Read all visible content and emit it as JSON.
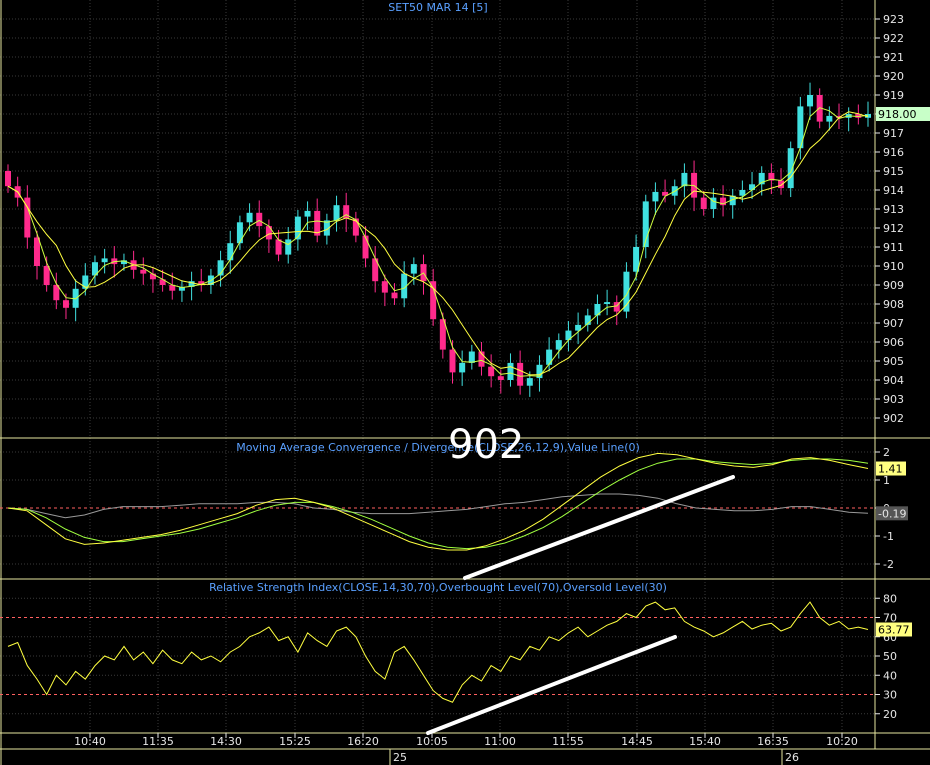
{
  "chart_data": [
    {
      "type": "candlestick",
      "title": "SET50 MAR 14   [5]",
      "ylim": [
        901,
        924
      ],
      "yticks": [
        902,
        903,
        904,
        905,
        906,
        907,
        908,
        909,
        910,
        911,
        912,
        913,
        914,
        915,
        916,
        917,
        918,
        919,
        920,
        921,
        922,
        923
      ],
      "last_price": "918.00",
      "annotation": "902",
      "colors": {
        "up": "#40e0e0",
        "down": "#ff2a8c",
        "ma": "#ffff40",
        "ma2": "#d0ff40",
        "tag_bg": "#c8ffc8"
      },
      "closes": [
        914.2,
        913.6,
        911.5,
        910.0,
        909.0,
        908.2,
        907.8,
        908.8,
        909.5,
        910.2,
        910.4,
        910.1,
        910.3,
        909.8,
        909.6,
        909.3,
        909.0,
        908.7,
        908.9,
        909.2,
        909.0,
        909.5,
        910.3,
        911.2,
        912.3,
        912.8,
        912.1,
        911.4,
        910.6,
        911.4,
        912.6,
        912.9,
        911.6,
        912.4,
        913.2,
        912.5,
        911.6,
        910.4,
        909.2,
        908.6,
        908.3,
        909.6,
        910.1,
        909.2,
        907.2,
        905.6,
        904.4,
        904.9,
        905.5,
        904.7,
        904.2,
        904.0,
        904.9,
        903.7,
        904.1,
        904.8,
        905.6,
        906.1,
        906.6,
        906.9,
        907.4,
        908.0,
        908.1,
        907.6,
        909.7,
        911.0,
        913.4,
        913.9,
        913.7,
        914.2,
        914.9,
        913.6,
        913.0,
        913.6,
        913.2,
        913.7,
        914.0,
        914.3,
        914.9,
        914.5,
        914.1,
        916.2,
        918.4,
        919.0,
        917.6,
        917.9,
        917.8,
        918.0,
        917.8,
        918.0
      ],
      "note_closes": "approximate closes read from candles; OHLC derived"
    },
    {
      "type": "line",
      "title": "Moving Average Convergence / Divergence(CLOSE,26,12,9),Value Line(0)",
      "ylim": [
        -2.5,
        2.5
      ],
      "yticks": [
        -2,
        -1,
        0,
        1,
        2
      ],
      "labels": {
        "macd": "1.41",
        "hist": "-0.19"
      },
      "colors": {
        "macd": "#ffff40",
        "signal": "#a0ff40",
        "hist": "#9a9a9a",
        "zero": "#ff6060",
        "tag_bg": "#ffff80"
      },
      "macd": [
        0.0,
        -0.1,
        -0.6,
        -1.1,
        -1.3,
        -1.25,
        -1.15,
        -1.05,
        -0.95,
        -0.8,
        -0.6,
        -0.4,
        -0.2,
        0.1,
        0.3,
        0.35,
        0.2,
        0.0,
        -0.3,
        -0.6,
        -0.9,
        -1.2,
        -1.4,
        -1.5,
        -1.5,
        -1.35,
        -1.1,
        -0.8,
        -0.4,
        0.1,
        0.6,
        1.1,
        1.5,
        1.8,
        1.95,
        1.9,
        1.75,
        1.6,
        1.5,
        1.45,
        1.55,
        1.75,
        1.8,
        1.7,
        1.55,
        1.41
      ],
      "signal": [
        0.0,
        -0.05,
        -0.35,
        -0.75,
        -1.05,
        -1.2,
        -1.2,
        -1.1,
        -1.0,
        -0.9,
        -0.75,
        -0.55,
        -0.35,
        -0.1,
        0.1,
        0.2,
        0.2,
        0.05,
        -0.15,
        -0.4,
        -0.7,
        -1.0,
        -1.25,
        -1.4,
        -1.45,
        -1.4,
        -1.25,
        -1.0,
        -0.7,
        -0.3,
        0.15,
        0.6,
        1.0,
        1.35,
        1.6,
        1.75,
        1.75,
        1.65,
        1.6,
        1.55,
        1.6,
        1.7,
        1.75,
        1.75,
        1.7,
        1.6
      ],
      "hist": [
        0.0,
        -0.05,
        -0.2,
        -0.35,
        -0.25,
        -0.05,
        0.05,
        0.05,
        0.05,
        0.1,
        0.15,
        0.15,
        0.15,
        0.2,
        0.2,
        0.15,
        0.0,
        -0.05,
        -0.15,
        -0.2,
        -0.2,
        -0.2,
        -0.15,
        -0.1,
        -0.05,
        0.05,
        0.15,
        0.2,
        0.3,
        0.4,
        0.45,
        0.5,
        0.5,
        0.45,
        0.35,
        0.15,
        0.0,
        -0.05,
        -0.1,
        -0.1,
        -0.05,
        0.05,
        0.05,
        -0.05,
        -0.15,
        -0.19
      ]
    },
    {
      "type": "line",
      "title": "Relative Strength Index(CLOSE,14,30,70),Overbought Level(70),Oversold Level(30)",
      "ylim": [
        10,
        90
      ],
      "yticks": [
        20,
        30,
        40,
        50,
        60,
        70,
        80
      ],
      "levels": [
        30,
        70
      ],
      "label": "63.77",
      "colors": {
        "rsi": "#ffff40",
        "level": "#ff6060",
        "tag_bg": "#ffff80"
      },
      "values": [
        55,
        57,
        45,
        38,
        30,
        40,
        35,
        42,
        38,
        45,
        50,
        48,
        55,
        48,
        52,
        46,
        53,
        48,
        46,
        52,
        48,
        50,
        47,
        52,
        55,
        60,
        62,
        65,
        58,
        60,
        52,
        62,
        58,
        55,
        63,
        65,
        60,
        50,
        42,
        38,
        52,
        55,
        48,
        40,
        32,
        28,
        26,
        35,
        40,
        37,
        45,
        42,
        50,
        48,
        55,
        53,
        60,
        58,
        62,
        65,
        60,
        63,
        66,
        68,
        72,
        70,
        76,
        78,
        74,
        75,
        68,
        65,
        63,
        60,
        62,
        65,
        68,
        64,
        66,
        67,
        63,
        65,
        72,
        78,
        70,
        66,
        68,
        64,
        65,
        63.77
      ],
      "note": "rsi values approximate"
    }
  ],
  "x_axis": {
    "time_labels": [
      "10:40",
      "11:35",
      "14:30",
      "15:25",
      "16:20",
      "10:05",
      "11:00",
      "11:55",
      "14:45",
      "15:40",
      "16:35",
      "10:20"
    ],
    "date_labels": [
      "25",
      "26"
    ]
  }
}
